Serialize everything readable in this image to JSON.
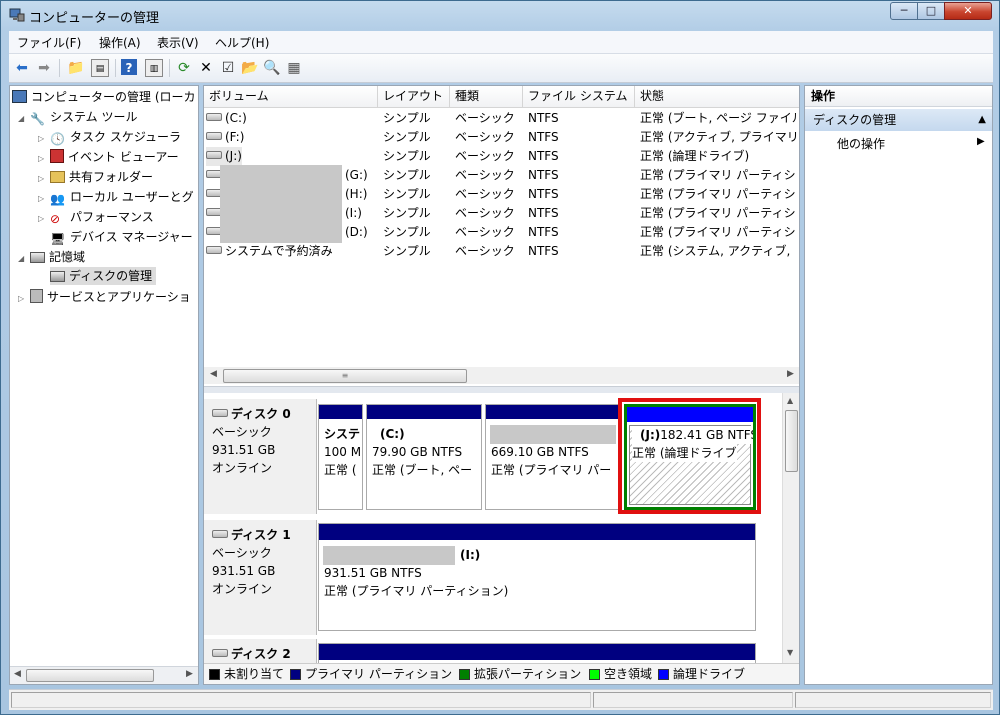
{
  "window": {
    "title": "コンピューターの管理",
    "min": "─",
    "max": "□",
    "close": "✕"
  },
  "menu": [
    "ファイル(F)",
    "操作(A)",
    "表示(V)",
    "ヘルプ(H)"
  ],
  "tree": {
    "root": "コンピューターの管理 (ローカ",
    "system_tools": "システム ツール",
    "task_scheduler": "タスク スケジューラ",
    "event_viewer": "イベント ビューアー",
    "shared_folders": "共有フォルダー",
    "local_users": "ローカル ユーザーとグ",
    "performance": "パフォーマンス",
    "device_manager": "デバイス マネージャー",
    "storage": "記憶域",
    "disk_management": "ディスクの管理",
    "services": "サービスとアプリケーショ"
  },
  "columns": [
    "ボリューム",
    "レイアウト",
    "種類",
    "ファイル システム",
    "状態"
  ],
  "volumes": [
    {
      "name": "(C:)",
      "layout": "シンプル",
      "type": "ベーシック",
      "fs": "NTFS",
      "status": "正常 (ブート, ページ ファイル"
    },
    {
      "name": "(F:)",
      "layout": "シンプル",
      "type": "ベーシック",
      "fs": "NTFS",
      "status": "正常 (アクティブ, プライマリ"
    },
    {
      "name": "(J:)",
      "layout": "シンプル",
      "type": "ベーシック",
      "fs": "NTFS",
      "status": "正常 (論理ドライブ)"
    },
    {
      "name": "(G:)",
      "layout": "シンプル",
      "type": "ベーシック",
      "fs": "NTFS",
      "status": "正常 (プライマリ パーティシ"
    },
    {
      "name": "(H:)",
      "layout": "シンプル",
      "type": "ベーシック",
      "fs": "NTFS",
      "status": "正常 (プライマリ パーティシ"
    },
    {
      "name": "(I:)",
      "layout": "シンプル",
      "type": "ベーシック",
      "fs": "NTFS",
      "status": "正常 (プライマリ パーティシ"
    },
    {
      "name": "(D:)",
      "layout": "シンプル",
      "type": "ベーシック",
      "fs": "NTFS",
      "status": "正常 (プライマリ パーティシ"
    },
    {
      "name": "システムで予約済み",
      "layout": "シンプル",
      "type": "ベーシック",
      "fs": "NTFS",
      "status": "正常 (システム, アクティブ,"
    }
  ],
  "disks": [
    {
      "name": "ディスク 0",
      "kind": "ベーシック",
      "size": "931.51 GB",
      "state": "オンライン",
      "parts": [
        {
          "label": "システ",
          "size": "100 M",
          "status": "正常 ("
        },
        {
          "label": "(C:)",
          "size": "79.90 GB NTFS",
          "status": "正常 (ブート, ペー"
        },
        {
          "label": "",
          "size": "669.10 GB NTFS",
          "status": "正常 (プライマリ パー"
        },
        {
          "label": "(J:)",
          "size": "182.41 GB NTFS",
          "status": "正常 (論理ドライブ"
        }
      ]
    },
    {
      "name": "ディスク 1",
      "kind": "ベーシック",
      "size": "931.51 GB",
      "state": "オンライン",
      "parts": [
        {
          "label": "(I:)",
          "size": "931.51 GB NTFS",
          "status": "正常 (プライマリ パーティション)"
        }
      ]
    },
    {
      "name": "ディスク 2"
    }
  ],
  "legend": [
    "未割り当て",
    "プライマリ パーティション",
    "拡張パーティション",
    "空き領域",
    "論理ドライブ"
  ],
  "legend_colors": [
    "#000000",
    "#000080",
    "#008000",
    "#00ff00",
    "#0000ff"
  ],
  "actions": {
    "header": "操作",
    "section": "ディスクの管理",
    "more": "他の操作"
  },
  "highlight_color": "#e01010"
}
